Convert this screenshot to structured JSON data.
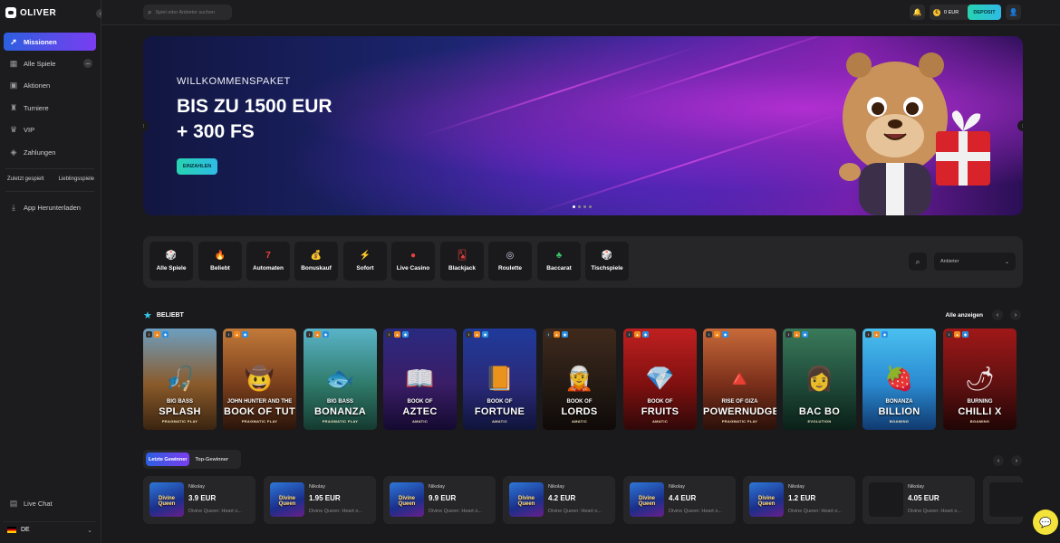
{
  "brand": {
    "name": "OLIVER"
  },
  "sidebar": {
    "items": [
      {
        "label": "Missionen",
        "icon": "rocket-icon"
      },
      {
        "label": "Alle Spiele",
        "icon": "grid-icon"
      },
      {
        "label": "Aktionen",
        "icon": "calendar-icon"
      },
      {
        "label": "Turniere",
        "icon": "trophy-icon"
      },
      {
        "label": "VIP",
        "icon": "crown-icon"
      },
      {
        "label": "Zahlungen",
        "icon": "wallet-icon"
      }
    ],
    "recent_label": "Zuletzt gespielt",
    "favorites_label": "Lieblingsspiele",
    "app_download": "App Herunterladen",
    "live_chat": "Live Chat",
    "language": "DE"
  },
  "topbar": {
    "search_placeholder": "Spiel oder Anbieter suchen",
    "balance": "0 EUR",
    "deposit_label": "DEPOSIT"
  },
  "hero": {
    "subtitle": "WILLKOMMENSPAKET",
    "title_line1": "BIS ZU 1500 EUR",
    "title_line2": "+ 300 FS",
    "cta": "EINZAHLEN"
  },
  "categories": [
    {
      "label": "Alle Spiele",
      "icon": "dice-icon",
      "glyph": "🎲"
    },
    {
      "label": "Beliebt",
      "icon": "fire-icon",
      "glyph": "🔥"
    },
    {
      "label": "Automaten",
      "icon": "seven-icon",
      "glyph": "7"
    },
    {
      "label": "Bonuskauf",
      "icon": "bag-icon",
      "glyph": "💰"
    },
    {
      "label": "Sofort",
      "icon": "lightning-icon",
      "glyph": "⚡"
    },
    {
      "label": "Live Casino",
      "icon": "chip-icon",
      "glyph": "●"
    },
    {
      "label": "Blackjack",
      "icon": "cards-icon",
      "glyph": "🂡"
    },
    {
      "label": "Roulette",
      "icon": "roulette-icon",
      "glyph": "◎"
    },
    {
      "label": "Baccarat",
      "icon": "baccarat-icon",
      "glyph": "♣"
    },
    {
      "label": "Tischspiele",
      "icon": "table-icon",
      "glyph": "🎲"
    }
  ],
  "provider_select": {
    "placeholder": "Anbieter"
  },
  "popular": {
    "title": "BELIEBT",
    "show_all": "Alle anzeigen",
    "games": [
      {
        "small": "BIG BASS",
        "big": "SPLASH",
        "provider": "PRAGMATIC PLAY",
        "bg": [
          "#6d9fc0",
          "#8a5a2a",
          "#3a2410"
        ],
        "art": "🎣"
      },
      {
        "small": "JOHN HUNTER AND THE",
        "big": "BOOK OF TUT",
        "provider": "PRAGMATIC PLAY",
        "bg": [
          "#c27a3a",
          "#7a3f1c",
          "#2a140a"
        ],
        "art": "🤠"
      },
      {
        "small": "BIG BASS",
        "big": "BONANZA",
        "provider": "PRAGMATIC PLAY",
        "bg": [
          "#5ab4c8",
          "#2f7a6a",
          "#153a30"
        ],
        "art": "🐟"
      },
      {
        "small": "BOOK OF",
        "big": "AZTEC",
        "provider": "AMATIC",
        "bg": [
          "#2a2a80",
          "#3a1d66",
          "#140a30"
        ],
        "art": "📖"
      },
      {
        "small": "BOOK OF",
        "big": "FORTUNE",
        "provider": "AMATIC",
        "bg": [
          "#1f3a9a",
          "#2a2a7a",
          "#0f143a"
        ],
        "art": "📙"
      },
      {
        "small": "BOOK OF",
        "big": "LORDS",
        "provider": "AMATIC",
        "bg": [
          "#3f2a1c",
          "#241a14",
          "#0f0a08"
        ],
        "art": "🧝"
      },
      {
        "small": "BOOK OF",
        "big": "FRUITS",
        "provider": "AMATIC",
        "bg": [
          "#c02020",
          "#801010",
          "#300808"
        ],
        "art": "💎"
      },
      {
        "small": "RISE OF GIZA",
        "big": "POWERNUDGE",
        "provider": "PRAGMATIC PLAY",
        "bg": [
          "#c86a3a",
          "#7a2f1a",
          "#2a100a"
        ],
        "art": "🔺"
      },
      {
        "small": "",
        "big": "BAC BO",
        "provider": "EVOLUTION",
        "bg": [
          "#3a7a5a",
          "#1f4a3a",
          "#0a2018"
        ],
        "art": "👩"
      },
      {
        "small": "BONANZA",
        "big": "BILLION",
        "provider": "BGAMING",
        "bg": [
          "#4ac0f0",
          "#2a8ad0",
          "#103a70"
        ],
        "art": "🍓"
      },
      {
        "small": "BURNING",
        "big": "CHILLI X",
        "provider": "BGAMING",
        "bg": [
          "#a01818",
          "#601010",
          "#200505"
        ],
        "art": "🌶"
      }
    ]
  },
  "winners": {
    "tabs": [
      "Letzte Gewinner",
      "Top-Gewinner"
    ],
    "items": [
      {
        "name": "Nikolay",
        "amount": "3.9 EUR",
        "game": "Divine Queen: Heart o...",
        "thumb": "Divine Queen"
      },
      {
        "name": "Nikolay",
        "amount": "1.95 EUR",
        "game": "Divine Queen: Heart o...",
        "thumb": "Divine Queen"
      },
      {
        "name": "Nikolay",
        "amount": "9.9 EUR",
        "game": "Divine Queen: Heart o...",
        "thumb": "Divine Queen"
      },
      {
        "name": "Nikolay",
        "amount": "4.2 EUR",
        "game": "Divine Queen: Heart o...",
        "thumb": "Divine Queen"
      },
      {
        "name": "Nikolay",
        "amount": "4.4 EUR",
        "game": "Divine Queen: Heart o...",
        "thumb": "Divine Queen"
      },
      {
        "name": "Nikolay",
        "amount": "1.2 EUR",
        "game": "Divine Queen: Heart o...",
        "thumb": "Divine Queen"
      },
      {
        "name": "Nikolay",
        "amount": "4.05 EUR",
        "game": "Divine Queen: Heart o...",
        "thumb": ""
      }
    ]
  },
  "colors": {
    "accent": "#2fbbe6",
    "active_gradient_start": "#2d5fe0",
    "active_gradient_end": "#7a3df0",
    "chat": "#f4e33a"
  }
}
